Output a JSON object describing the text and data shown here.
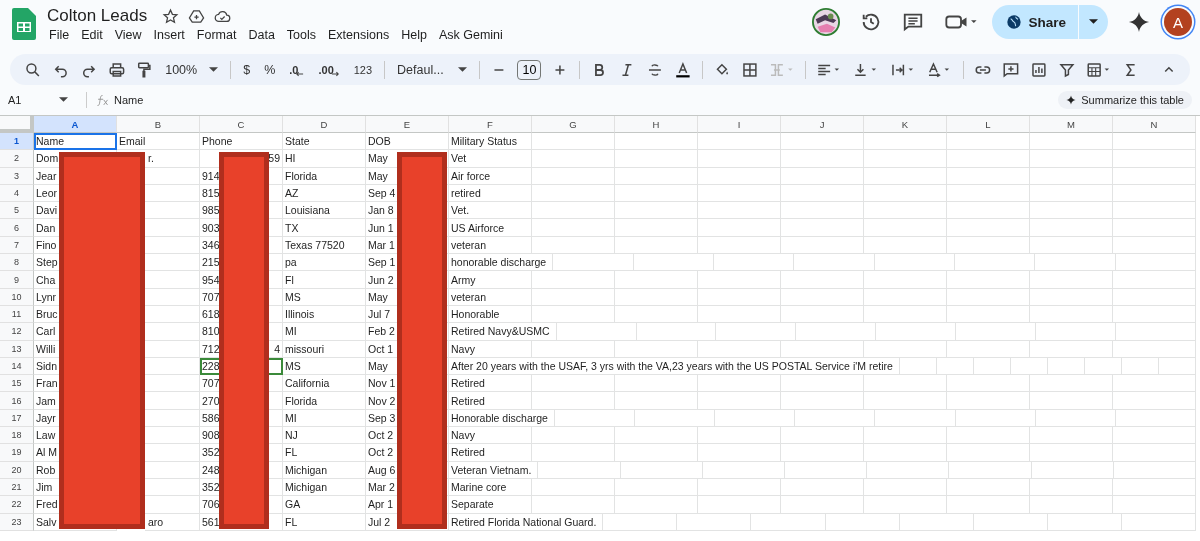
{
  "document": {
    "title": "Colton Leads"
  },
  "menu": [
    {
      "label": "File"
    },
    {
      "label": "Edit"
    },
    {
      "label": "View"
    },
    {
      "label": "Insert"
    },
    {
      "label": "Format"
    },
    {
      "label": "Data"
    },
    {
      "label": "Tools"
    },
    {
      "label": "Extensions"
    },
    {
      "label": "Help"
    },
    {
      "label": "Ask Gemini"
    }
  ],
  "share_button": {
    "label": "Share"
  },
  "account": {
    "initial": "A"
  },
  "toolbar": {
    "zoom": "100%",
    "currency": "$",
    "percent": "%",
    "decrease_decimal": ".0",
    "increase_decimal": ".00",
    "number_format": "123",
    "font": "Defaul...",
    "font_size": "10"
  },
  "formula_bar": {
    "cell_reference": "A1",
    "value": "Name"
  },
  "summarize_button": {
    "label": "Summarize this table"
  },
  "columns": [
    {
      "letter": "A",
      "selected": true,
      "redacted": true
    },
    {
      "letter": "B",
      "selected": false,
      "redacted": false
    },
    {
      "letter": "C",
      "selected": false,
      "redacted": true
    },
    {
      "letter": "D",
      "selected": false,
      "redacted": false
    },
    {
      "letter": "E",
      "selected": false,
      "redacted": true
    },
    {
      "letter": "F",
      "selected": false,
      "redacted": false
    },
    {
      "letter": "G",
      "selected": false,
      "redacted": false
    },
    {
      "letter": "H",
      "selected": false,
      "redacted": false
    },
    {
      "letter": "I",
      "selected": false,
      "redacted": false
    },
    {
      "letter": "J",
      "selected": false,
      "redacted": false
    },
    {
      "letter": "K",
      "selected": false,
      "redacted": false
    },
    {
      "letter": "L",
      "selected": false,
      "redacted": false
    },
    {
      "letter": "M",
      "selected": false,
      "redacted": false
    },
    {
      "letter": "N",
      "selected": false,
      "redacted": false
    }
  ],
  "rows": [
    {
      "number": "1",
      "selected": true,
      "cursor": false,
      "cells": [
        "Name",
        "Email",
        "Phone",
        "State",
        "DOB",
        "Military Status"
      ]
    },
    {
      "number": "2",
      "selected": false,
      "cursor": false,
      "cells": [
        "Dom",
        "r.",
        "",
        "HI",
        "May",
        "Vet"
      ],
      "phone_tail": "59"
    },
    {
      "number": "3",
      "selected": false,
      "cursor": false,
      "cells": [
        "Jear",
        "",
        "914",
        "Florida",
        "May",
        "Air force"
      ]
    },
    {
      "number": "4",
      "selected": false,
      "cursor": false,
      "cells": [
        "Leor",
        "",
        "815",
        "AZ",
        "Sep 4",
        "retired"
      ]
    },
    {
      "number": "5",
      "selected": false,
      "cursor": false,
      "cells": [
        "Davi",
        "",
        "985",
        "Louisiana",
        "Jan 8",
        "Vet."
      ]
    },
    {
      "number": "6",
      "selected": false,
      "cursor": false,
      "cells": [
        "Dan",
        "",
        "903",
        "TX",
        "Jun 1",
        "US Airforce"
      ]
    },
    {
      "number": "7",
      "selected": false,
      "cursor": false,
      "cells": [
        "Fino",
        "",
        "346",
        "Texas 77520",
        "Mar 1",
        "veteran"
      ]
    },
    {
      "number": "8",
      "selected": false,
      "cursor": false,
      "cells": [
        "Step",
        "",
        "215",
        "pa",
        "Sep 1",
        "honorable discharge"
      ]
    },
    {
      "number": "9",
      "selected": false,
      "cursor": false,
      "cells": [
        "Cha",
        "",
        "954",
        "Fl",
        "Jun 2",
        "Army"
      ]
    },
    {
      "number": "10",
      "selected": false,
      "cursor": false,
      "cells": [
        "Lynr",
        "",
        "707",
        "MS",
        "May",
        "veteran"
      ]
    },
    {
      "number": "11",
      "selected": false,
      "cursor": false,
      "cells": [
        "Bruc",
        "",
        "618",
        "Illinois",
        "Jul 7",
        "Honorable"
      ]
    },
    {
      "number": "12",
      "selected": false,
      "cursor": false,
      "cells": [
        "Carl",
        "",
        "810",
        "MI",
        "Feb 2",
        "Retired Navy&USMC"
      ]
    },
    {
      "number": "13",
      "selected": false,
      "cursor": false,
      "cells": [
        "Willi",
        "",
        "712",
        "missouri",
        "Oct 1",
        "Navy"
      ],
      "phone_tail": "4"
    },
    {
      "number": "14",
      "selected": false,
      "cursor": true,
      "cells": [
        "Sidn",
        "",
        "228",
        "MS",
        "May",
        "After 20 years with the USAF, 3 yrs with the VA,23  years with the US POSTAL Service  i'M retire"
      ]
    },
    {
      "number": "15",
      "selected": false,
      "cursor": false,
      "cells": [
        "Fran",
        "",
        "707",
        "California",
        "Nov 1",
        "Retired"
      ]
    },
    {
      "number": "16",
      "selected": false,
      "cursor": false,
      "cells": [
        "Jam",
        "",
        "270",
        "Florida",
        "Nov 2",
        "Retired"
      ]
    },
    {
      "number": "17",
      "selected": false,
      "cursor": false,
      "cells": [
        "Jayr",
        "",
        "586",
        "MI",
        "Sep 3",
        "Honorable discharge"
      ]
    },
    {
      "number": "18",
      "selected": false,
      "cursor": false,
      "cells": [
        "Law",
        "",
        "908",
        "NJ",
        "Oct 2",
        "Navy"
      ]
    },
    {
      "number": "19",
      "selected": false,
      "cursor": false,
      "cells": [
        "Al M",
        "",
        "352",
        "FL",
        "Oct 2",
        "Retired"
      ]
    },
    {
      "number": "20",
      "selected": false,
      "cursor": false,
      "cells": [
        "Rob",
        "",
        "248",
        "Michigan",
        "Aug 6",
        "Veteran Vietnam."
      ]
    },
    {
      "number": "21",
      "selected": false,
      "cursor": false,
      "cells": [
        "Jim",
        "",
        "352",
        "Michigan",
        "Mar 2",
        "Marine core"
      ]
    },
    {
      "number": "22",
      "selected": false,
      "cursor": false,
      "cells": [
        "Fred",
        "",
        "706",
        "GA",
        "Apr 1",
        "Separate"
      ]
    },
    {
      "number": "23",
      "selected": false,
      "cursor": false,
      "cells": [
        "Salv",
        "aro",
        "561",
        "FL",
        "Jul 2",
        "Retired Florida National Guard."
      ]
    }
  ]
}
